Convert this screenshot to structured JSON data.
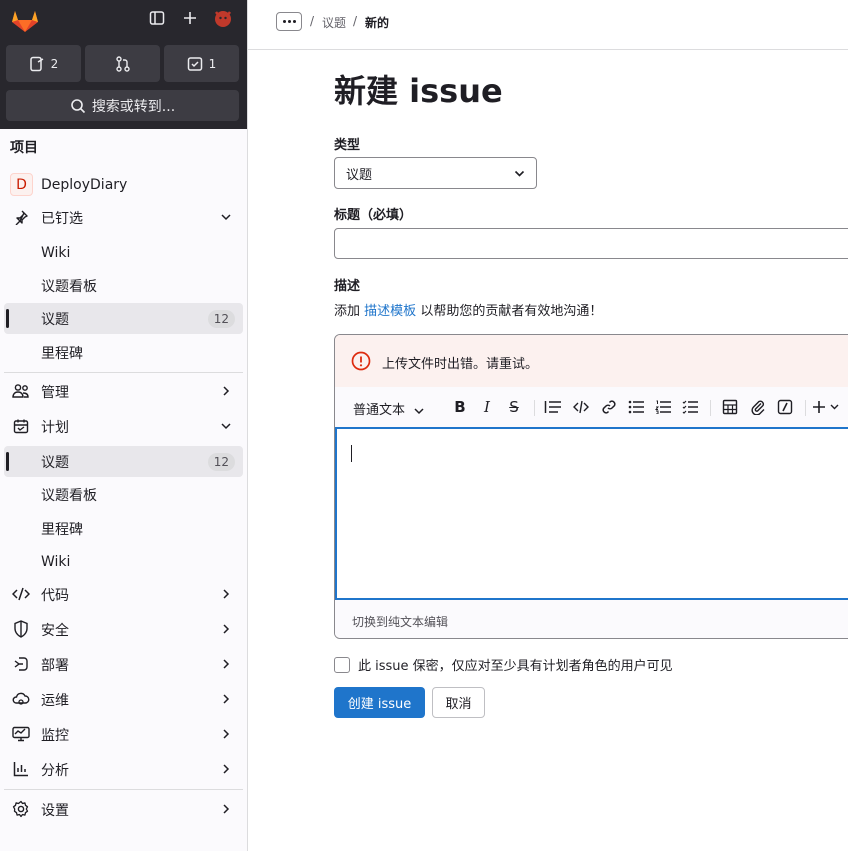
{
  "sidebar": {
    "counters": {
      "issues": "2",
      "merge_requests": "",
      "todos": "1"
    },
    "search_label": "搜索或转到...",
    "section_title": "项目",
    "project": {
      "initial": "D",
      "name": "DeployDiary"
    },
    "pinned": {
      "label": "已钉选",
      "items": [
        "Wiki",
        "议题看板",
        "议题",
        "里程碑"
      ],
      "issues_badge": "12"
    },
    "manage": "管理",
    "plan": {
      "label": "计划",
      "items": [
        "议题",
        "议题看板",
        "里程碑",
        "Wiki"
      ],
      "issues_badge": "12"
    },
    "code": "代码",
    "secure": "安全",
    "deploy": "部署",
    "operate": "运维",
    "monitor": "监控",
    "analyze": "分析",
    "settings": "设置"
  },
  "breadcrumb": {
    "parent": "议题",
    "current": "新的",
    "sep": "/"
  },
  "page": {
    "title": "新建 issue",
    "type_label": "类型",
    "type_value": "议题",
    "title_label": "标题（必填）",
    "desc_label": "描述",
    "help_prefix": "添加",
    "help_link": "描述模板",
    "help_suffix": "以帮助您的贡献者有效地沟通！",
    "error": "上传文件时出错。请重试。",
    "text_style": "普通文本",
    "switch_plain": "切换到纯文本编辑",
    "confidential": "此 issue 保密，仅应对至少具有计划者角色的用户可见",
    "create_btn": "创建 issue",
    "cancel_btn": "取消"
  },
  "colors": {
    "primary": "#1f75cb",
    "error": "#dd2b0e",
    "sidebar_dark": "#28272d"
  }
}
